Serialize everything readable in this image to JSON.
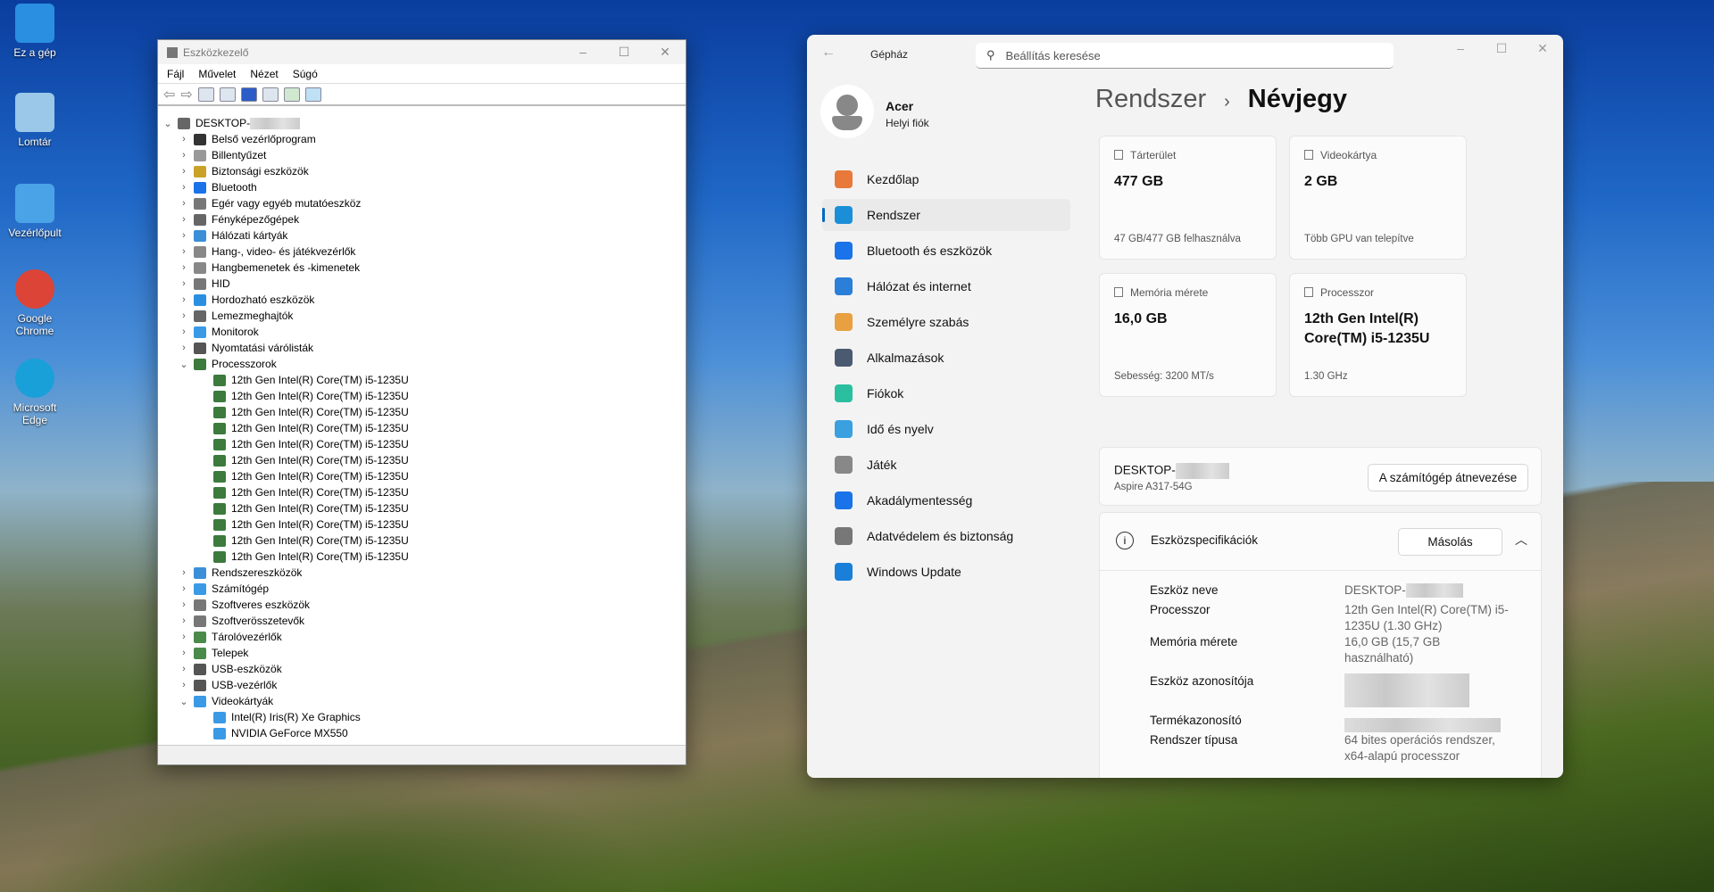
{
  "desktop": {
    "icons": [
      {
        "label": "Ez a gép",
        "color": "#2a8fe0"
      },
      {
        "label": "Lomtár",
        "color": "#9bc7e8"
      },
      {
        "label": "Vezérlőpult",
        "color": "#4aa3e6"
      },
      {
        "label": "Google Chrome",
        "color": "#db4437"
      },
      {
        "label": "Microsoft Edge",
        "color": "#1aa0d8"
      }
    ]
  },
  "device_manager": {
    "title": "Eszközkezelő",
    "menu": [
      "Fájl",
      "Művelet",
      "Nézet",
      "Súgó"
    ],
    "root": "DESKTOP-",
    "tree": [
      {
        "label": "Belső vezérlőprogram",
        "color": "#333"
      },
      {
        "label": "Billentyűzet",
        "color": "#999"
      },
      {
        "label": "Biztonsági eszközök",
        "color": "#c9a227"
      },
      {
        "label": "Bluetooth",
        "color": "#1a73e8"
      },
      {
        "label": "Egér vagy egyéb mutatóeszköz",
        "color": "#777"
      },
      {
        "label": "Fényképezőgépek",
        "color": "#666"
      },
      {
        "label": "Hálózati kártyák",
        "color": "#3a8fd8"
      },
      {
        "label": "Hang-, video- és játékvezérlők",
        "color": "#888"
      },
      {
        "label": "Hangbemenetek és -kimenetek",
        "color": "#888"
      },
      {
        "label": "HID",
        "color": "#777"
      },
      {
        "label": "Hordozható eszközök",
        "color": "#2a8fe0"
      },
      {
        "label": "Lemezmeghajtók",
        "color": "#666"
      },
      {
        "label": "Monitorok",
        "color": "#3a9ae6"
      },
      {
        "label": "Nyomtatási várólisták",
        "color": "#555"
      },
      {
        "label": "Processzorok",
        "color": "#3d7a3d",
        "expanded": true,
        "children": [
          "12th Gen Intel(R) Core(TM) i5-1235U",
          "12th Gen Intel(R) Core(TM) i5-1235U",
          "12th Gen Intel(R) Core(TM) i5-1235U",
          "12th Gen Intel(R) Core(TM) i5-1235U",
          "12th Gen Intel(R) Core(TM) i5-1235U",
          "12th Gen Intel(R) Core(TM) i5-1235U",
          "12th Gen Intel(R) Core(TM) i5-1235U",
          "12th Gen Intel(R) Core(TM) i5-1235U",
          "12th Gen Intel(R) Core(TM) i5-1235U",
          "12th Gen Intel(R) Core(TM) i5-1235U",
          "12th Gen Intel(R) Core(TM) i5-1235U",
          "12th Gen Intel(R) Core(TM) i5-1235U"
        ]
      },
      {
        "label": "Rendszereszközök",
        "color": "#3a8fd8"
      },
      {
        "label": "Számítógép",
        "color": "#3a9ae6"
      },
      {
        "label": "Szoftveres eszközök",
        "color": "#777"
      },
      {
        "label": "Szoftverösszetevők",
        "color": "#777"
      },
      {
        "label": "Tárolóvezérlők",
        "color": "#4a8a4a"
      },
      {
        "label": "Telepek",
        "color": "#4a8a4a"
      },
      {
        "label": "USB-eszközök",
        "color": "#555"
      },
      {
        "label": "USB-vezérlők",
        "color": "#555"
      },
      {
        "label": "Videokártyák",
        "color": "#3a9ae6",
        "expanded": true,
        "children": [
          "Intel(R) Iris(R) Xe Graphics",
          "NVIDIA GeForce MX550"
        ]
      }
    ]
  },
  "settings": {
    "app_title": "Gépház",
    "search_placeholder": "Beállítás keresése",
    "user": {
      "name": "Acer",
      "account": "Helyi fiók"
    },
    "nav": [
      {
        "label": "Kezdőlap",
        "color": "#e8793a"
      },
      {
        "label": "Rendszer",
        "color": "#1a8fd8",
        "selected": true
      },
      {
        "label": "Bluetooth és eszközök",
        "color": "#1a73e8"
      },
      {
        "label": "Hálózat és internet",
        "color": "#2a7fd8"
      },
      {
        "label": "Személyre szabás",
        "color": "#e8a040"
      },
      {
        "label": "Alkalmazások",
        "color": "#4a5a70"
      },
      {
        "label": "Fiókok",
        "color": "#2abf9e"
      },
      {
        "label": "Idő és nyelv",
        "color": "#3aa0e0"
      },
      {
        "label": "Játék",
        "color": "#888"
      },
      {
        "label": "Akadálymentesség",
        "color": "#1a73e8"
      },
      {
        "label": "Adatvédelem és biztonság",
        "color": "#777"
      },
      {
        "label": "Windows Update",
        "color": "#1a7fd8"
      }
    ],
    "breadcrumb": {
      "parent": "Rendszer",
      "sep": "›",
      "current": "Névjegy"
    },
    "cards": [
      {
        "label": "Tárterület",
        "value": "477 GB",
        "sub": "47 GB/477 GB felhasználva"
      },
      {
        "label": "Videokártya",
        "value": "2 GB",
        "sub": "Több GPU van telepítve"
      },
      {
        "label": "Memória mérete",
        "value": "16,0 GB",
        "sub": "Sebesség: 3200 MT/s"
      },
      {
        "label": "Processzor",
        "value": "12th Gen Intel(R) Core(TM) i5-1235U",
        "sub": "1.30 GHz"
      }
    ],
    "device": {
      "name": "DESKTOP-",
      "model": "Aspire A317-54G",
      "rename_button": "A számítógép átnevezése"
    },
    "specs": {
      "title": "Eszközspecifikációk",
      "copy_button": "Másolás",
      "rows": [
        {
          "label": "Eszköz neve",
          "value": "DESKTOP-"
        },
        {
          "label": "Processzor",
          "value": "12th Gen Intel(R) Core(TM) i5-1235U (1.30 GHz)"
        },
        {
          "label": "Memória mérete",
          "value": "16,0 GB (15,7 GB használható)"
        },
        {
          "label": "Eszköz azonosítója",
          "value": ""
        },
        {
          "label": "Termékazonosító",
          "value": ""
        },
        {
          "label": "Rendszer típusa",
          "value": "64 bites operációs rendszer, x64-alapú processzor"
        }
      ]
    }
  }
}
